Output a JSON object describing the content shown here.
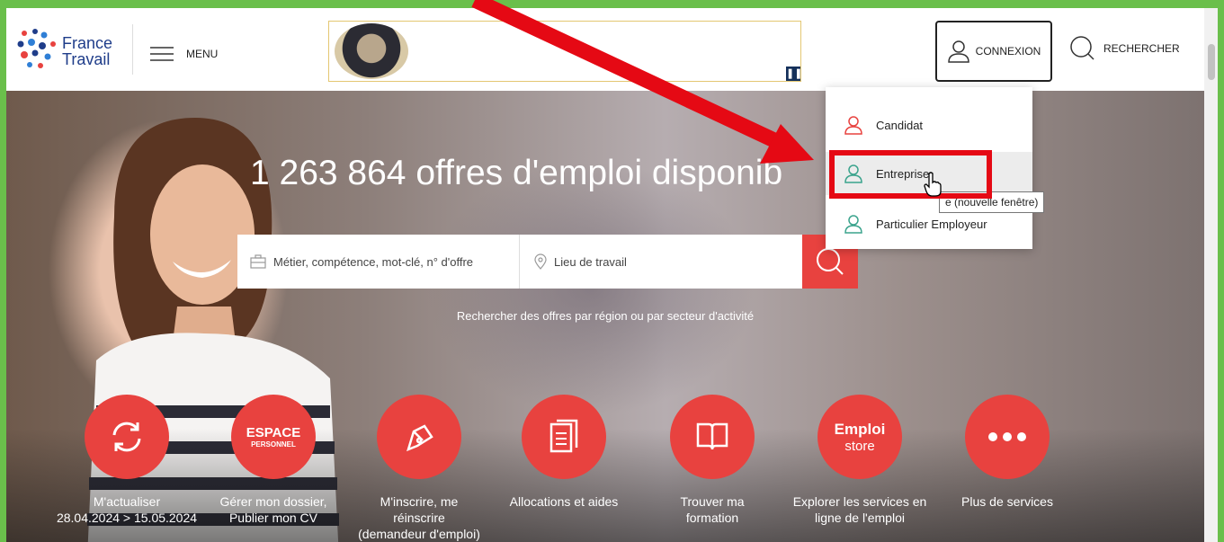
{
  "header": {
    "logo_line1": "France",
    "logo_line2": "Travail",
    "menu_label": "MENU",
    "connexion_label": "CONNEXION",
    "rechercher_label": "RECHERCHER"
  },
  "hero": {
    "title": "1 263 864 offres d'emploi disponib",
    "search_job_placeholder": "Métier, compétence, mot-clé, n° d'offre",
    "search_place_placeholder": "Lieu de travail",
    "search_link": "Rechercher des offres par région ou par secteur d'activité"
  },
  "dropdown": {
    "items": [
      {
        "label": "Candidat",
        "color": "#e8423f"
      },
      {
        "label": "Entreprise",
        "color": "#3aa38c"
      },
      {
        "label": "Particulier Employeur",
        "color": "#3aa38c"
      }
    ],
    "tooltip": "e (nouvelle fenêtre)"
  },
  "services": [
    {
      "icon": "refresh-icon",
      "line1": "M'actualiser",
      "line2": "28.04.2024 > 15.05.2024",
      "line3": ""
    },
    {
      "icon": "espace-personnel-icon",
      "badge1": "ESPACE",
      "badge2": "PERSONNEL",
      "line1": "Gérer mon dossier,",
      "line2": "Publier mon CV",
      "line3": ""
    },
    {
      "icon": "pen-icon",
      "line1": "M'inscrire, me",
      "line2": "réinscrire",
      "line3": "(demandeur d'emploi)"
    },
    {
      "icon": "document-icon",
      "line1": "Allocations et aides",
      "line2": "",
      "line3": ""
    },
    {
      "icon": "book-icon",
      "line1": "Trouver ma",
      "line2": "formation",
      "line3": ""
    },
    {
      "icon": "emploi-store-icon",
      "badge1": "Emploi",
      "badge2": "store",
      "line1": "Explorer les services en",
      "line2": "ligne de l'emploi",
      "line3": ""
    },
    {
      "icon": "more-icon",
      "line1": "Plus de services",
      "line2": "",
      "line3": ""
    }
  ],
  "colors": {
    "accent": "#e8423f",
    "annotation": "#e50914",
    "border": "#6abf4b"
  }
}
